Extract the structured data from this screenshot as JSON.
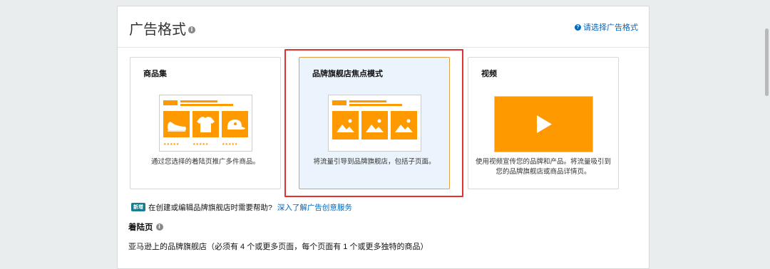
{
  "header": {
    "title": "广告格式",
    "help_link": "请选择广告格式"
  },
  "cards": [
    {
      "title": "商品集",
      "description": "通过您选择的着陆页推广多件商品。",
      "selected": false
    },
    {
      "title": "品牌旗舰店焦点模式",
      "description": "将流量引导到品牌旗舰店，包括子页面。",
      "selected": true
    },
    {
      "title": "视频",
      "description": "使用视频宣传您的品牌和产品。将流量吸引到您的品牌旗舰店或商品详情页。",
      "selected": false
    }
  ],
  "help_row": {
    "badge": "新增",
    "question": "在创建或编辑品牌旗舰店时需要帮助?",
    "link": "深入了解广告创意服务"
  },
  "landing": {
    "label": "着陆页",
    "text": "亚马逊上的品牌旗舰店（必须有 4 个或更多页面，每个页面有 1 个或更多独特的商品）"
  },
  "colors": {
    "accent": "#ff9900",
    "link": "#0066c0",
    "highlight": "#e03131",
    "selected_bg": "#ebf4fc"
  }
}
